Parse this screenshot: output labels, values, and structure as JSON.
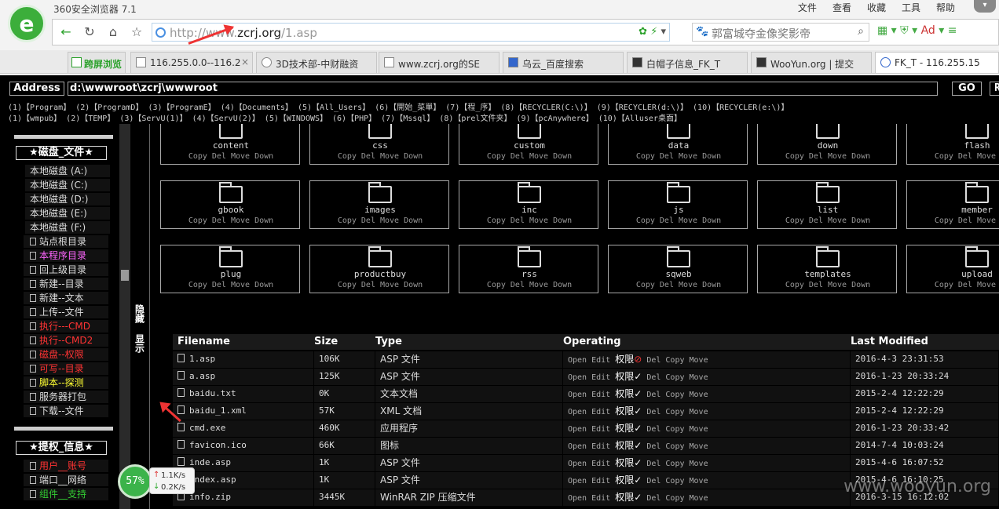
{
  "browser": {
    "title": "360安全浏览器 7.1",
    "menu": [
      "文件",
      "查看",
      "收藏",
      "工具",
      "帮助"
    ],
    "url_prefix": "http://www.",
    "url_domain": "zcrj.org",
    "url_path": "/1.asp",
    "search_placeholder": "郭富城夺金像奖影帝",
    "fast_view": "跨屏浏览",
    "tabs": [
      "116.255.0.0--116.2",
      "3D技术部-中财融资",
      "www.zcrj.org的SE",
      "乌云_百度搜索",
      "白帽子信息_FK_T",
      "WooYun.org | 提交",
      "FK_T - 116.255.15"
    ]
  },
  "page": {
    "address_label": "Address",
    "address_value": "d:\\wwwroot\\zcrj\\wwwroot",
    "go_label": "GO",
    "r_label": "R",
    "quick1": [
      "(1)【Program】",
      "(2)【ProgramD】",
      "(3)【ProgramE】",
      "(4)【Documents】",
      "(5)【All_Users】",
      "(6)【開始_菜單】",
      "(7)【程_序】",
      "(8)【RECYCLER(C:\\)】",
      "(9)【RECYCLER(d:\\)】",
      "(10)【RECYCLER(e:\\)】"
    ],
    "quick2": [
      "(1)【wmpub】",
      "(2)【TEMP】",
      "(3)【ServU(1)】",
      "(4)【ServU(2)】",
      "(5)【WINDOWS】",
      "(6)【PHP】",
      "(7)【Mssql】",
      "(8)【prel文件夹】",
      "(9)【pcAnywhere】",
      "(10)【Alluser桌面】"
    ]
  },
  "sidebar": {
    "disk_head": "★磁盘_文件★",
    "drives": [
      "本地磁盘 (A:)",
      "本地磁盘 (C:)",
      "本地磁盘 (D:)",
      "本地磁盘 (E:)",
      "本地磁盘 (F:)"
    ],
    "items": [
      {
        "label": "站点根目录",
        "color": "#dddddd"
      },
      {
        "label": "本程序目录",
        "color": "#ff66ff"
      },
      {
        "label": "回上级目录",
        "color": "#dddddd"
      },
      {
        "label": "新建--目录",
        "color": "#dddddd"
      },
      {
        "label": "新建--文本",
        "color": "#dddddd"
      },
      {
        "label": "上传--文件",
        "color": "#dddddd"
      },
      {
        "label": "执行---CMD",
        "color": "#ff3333"
      },
      {
        "label": "执行--CMD2",
        "color": "#ff3333"
      },
      {
        "label": "磁盘--权限",
        "color": "#ff3333"
      },
      {
        "label": "可写--目录",
        "color": "#ff3333"
      },
      {
        "label": "脚本--探测",
        "color": "#ffff33"
      },
      {
        "label": "服务器打包",
        "color": "#dddddd"
      },
      {
        "label": "下载--文件",
        "color": "#dddddd"
      }
    ],
    "priv_head": "★提权_信息★",
    "priv_items": [
      {
        "label": "用户__账号",
        "color": "#ff3333"
      },
      {
        "label": "端口__网络",
        "color": "#dddddd"
      },
      {
        "label": "组件__支持",
        "color": "#33cc33"
      }
    ]
  },
  "hide_label": "隐藏",
  "show_label": "显示",
  "folders": [
    {
      "name": "content"
    },
    {
      "name": "css"
    },
    {
      "name": "custom"
    },
    {
      "name": "data"
    },
    {
      "name": "down"
    },
    {
      "name": "flash"
    },
    {
      "name": "gbook"
    },
    {
      "name": "images"
    },
    {
      "name": "inc"
    },
    {
      "name": "js"
    },
    {
      "name": "list"
    },
    {
      "name": "member"
    },
    {
      "name": "plug"
    },
    {
      "name": "productbuy"
    },
    {
      "name": "rss"
    },
    {
      "name": "sqweb"
    },
    {
      "name": "templates"
    },
    {
      "name": "upload"
    }
  ],
  "folder_ops": "Copy Del Move Down",
  "table": {
    "headers": [
      "Filename",
      "Size",
      "Type",
      "Operating",
      "Last Modified"
    ],
    "ops_left": "Open Edit",
    "perm": "权限",
    "ops_right": "Del Copy Move",
    "rows": [
      {
        "name": "1.asp",
        "size": "106K",
        "type": "ASP 文件",
        "mark": "⊘",
        "date": "2016-4-3 23:31:53"
      },
      {
        "name": "a.asp",
        "size": "125K",
        "type": "ASP 文件",
        "mark": "✓",
        "date": "2016-1-23 20:33:24"
      },
      {
        "name": "baidu.txt",
        "size": "0K",
        "type": "文本文档",
        "mark": "✓",
        "date": "2015-2-4 12:22:29"
      },
      {
        "name": "baidu_1.xml",
        "size": "57K",
        "type": "XML 文档",
        "mark": "✓",
        "date": "2015-2-4 12:22:29"
      },
      {
        "name": "cmd.exe",
        "size": "460K",
        "type": "应用程序",
        "mark": "✓",
        "date": "2016-1-23 20:33:42"
      },
      {
        "name": "favicon.ico",
        "size": "66K",
        "type": "图标",
        "mark": "✓",
        "date": "2014-7-4 10:03:24"
      },
      {
        "name": "inde.asp",
        "size": "1K",
        "type": "ASP 文件",
        "mark": "✓",
        "date": "2015-4-6 16:07:52"
      },
      {
        "name": "index.asp",
        "size": "1K",
        "type": "ASP 文件",
        "mark": "✓",
        "date": "2015-4-6 16:10:25"
      },
      {
        "name": "info.zip",
        "size": "3445K",
        "type": "WinRAR ZIP 压缩文件",
        "mark": "✓",
        "date": "2016-3-15 16:12:02"
      }
    ]
  },
  "net": {
    "percent": "57%",
    "up": "1.1K/s",
    "down": "0.2K/s"
  },
  "watermark": "www.wooyun.org"
}
